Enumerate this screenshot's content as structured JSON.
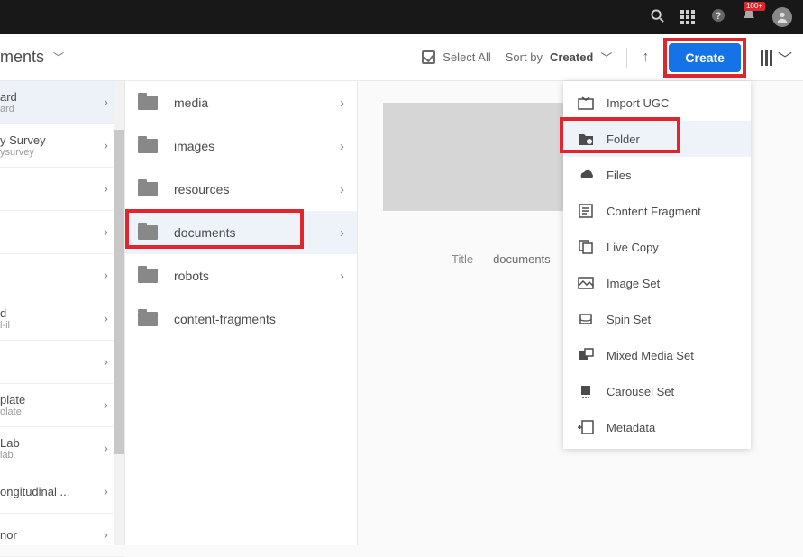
{
  "top": {
    "badge": "100+"
  },
  "header": {
    "breadcrumb": "ments",
    "select_all": "Select All",
    "sort_label": "Sort by",
    "sort_value": "Created",
    "create": "Create"
  },
  "col1": [
    {
      "label": "ard",
      "sub": "ard",
      "selected": true
    },
    {
      "label": "y Survey",
      "sub": "ysurvey"
    },
    {
      "label": "",
      "sub": ""
    },
    {
      "label": "",
      "sub": ""
    },
    {
      "label": "",
      "sub": ""
    },
    {
      "label": "d",
      "sub": "l-il"
    },
    {
      "label": "",
      "sub": ""
    },
    {
      "label": "plate",
      "sub": "olate"
    },
    {
      "label": "Lab",
      "sub": "lab"
    },
    {
      "label": "ongitudinal ...",
      "sub": ""
    },
    {
      "label": "nor",
      "sub": ""
    }
  ],
  "col2": [
    {
      "label": "media",
      "chev": true
    },
    {
      "label": "images",
      "chev": true
    },
    {
      "label": "resources",
      "chev": true
    },
    {
      "label": "documents",
      "chev": true,
      "selected": true,
      "highlight": true
    },
    {
      "label": "robots",
      "chev": true
    },
    {
      "label": "content-fragments",
      "chev": false
    }
  ],
  "details": {
    "title_key": "Title",
    "title_val": "documents"
  },
  "dropdown": [
    {
      "icon": "ugc",
      "label": "Import UGC"
    },
    {
      "icon": "folder",
      "label": "Folder",
      "selected": true,
      "highlight": true
    },
    {
      "icon": "cloud",
      "label": "Files"
    },
    {
      "icon": "fragment",
      "label": "Content Fragment"
    },
    {
      "icon": "copy",
      "label": "Live Copy"
    },
    {
      "icon": "imageset",
      "label": "Image Set"
    },
    {
      "icon": "spin",
      "label": "Spin Set"
    },
    {
      "icon": "mixed",
      "label": "Mixed Media Set"
    },
    {
      "icon": "carousel",
      "label": "Carousel Set"
    },
    {
      "icon": "meta",
      "label": "Metadata"
    }
  ]
}
